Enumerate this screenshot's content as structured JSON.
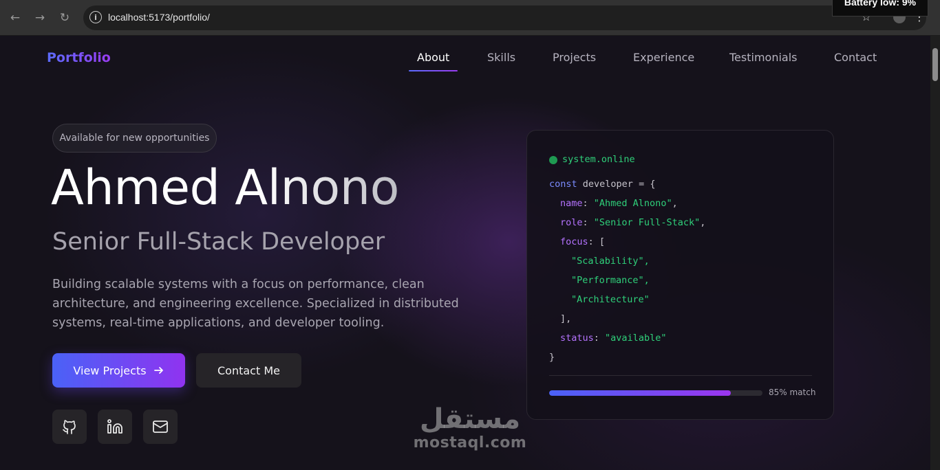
{
  "browser": {
    "url": "localhost:5173/portfolio/",
    "notification": "Battery low: 9%"
  },
  "nav": {
    "brand": "Portfolio",
    "items": [
      "About",
      "Skills",
      "Projects",
      "Experience",
      "Testimonials",
      "Contact"
    ],
    "active": "About"
  },
  "hero": {
    "badge": "Available for new opportunities",
    "name": "Ahmed Alnono",
    "role": "Senior Full-Stack Developer",
    "description": "Building scalable systems with a focus on performance, clean architecture, and engineering excellence. Specialized in distributed systems, real-time applications, and developer tooling.",
    "primary_button": "View Projects",
    "secondary_button": "Contact Me",
    "social_icons": [
      "github-icon",
      "linkedin-icon",
      "mail-icon"
    ]
  },
  "card": {
    "status": "system.online",
    "code": {
      "keyword": "const",
      "variable": "developer",
      "name_key": "name",
      "name_value": "\"Ahmed Alnono\"",
      "role_key": "role",
      "role_value": "\"Senior Full-Stack\"",
      "focus_key": "focus",
      "focus_items": [
        "\"Scalability\",",
        "\"Performance\",",
        "\"Architecture\""
      ],
      "status_key": "status",
      "status_value": "\"available\""
    },
    "match_percent": 85,
    "match_label": "85% match"
  },
  "watermark": {
    "arabic": "مستقل",
    "latin": "mostaql.com"
  },
  "colors": {
    "accent_start": "#4a62f7",
    "accent_end": "#9033f0",
    "online_green": "#2fd07a"
  }
}
